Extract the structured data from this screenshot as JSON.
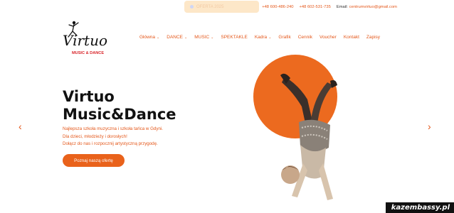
{
  "topbar": {
    "offer_text": "OFERTA 2025",
    "phone1": "+48 600-486-240",
    "phone2": "+48 602-531-735",
    "email_label": "Email:",
    "email": "centrumvirtuo@gmail.com"
  },
  "logo": {
    "wordmark": "Virtuo",
    "tagline": "MUSIC & DANCE"
  },
  "nav": {
    "items": [
      {
        "label": "Główna",
        "dropdown": true
      },
      {
        "label": "DANCE",
        "dropdown": true
      },
      {
        "label": "MUSIC",
        "dropdown": true
      },
      {
        "label": "SPEKTAKLE",
        "dropdown": false
      },
      {
        "label": "Kadra",
        "dropdown": true
      },
      {
        "label": "Grafik",
        "dropdown": false
      },
      {
        "label": "Cennik",
        "dropdown": false
      },
      {
        "label": "Voucher",
        "dropdown": false
      },
      {
        "label": "Kontakt",
        "dropdown": false
      },
      {
        "label": "Zapisy",
        "dropdown": false
      }
    ],
    "chevron": "⌄"
  },
  "hero": {
    "title_line1": "Virtuo",
    "title_line2": "Music&Dance",
    "desc_line1": "Najlepsza szkoła muzyczna i szkoła tańca w Gdyni.",
    "desc_line2": "Dla dzieci, młodzieży i dorosłych!",
    "desc_line3": "Dołącz do nas i rozpocznij artystyczną przygodę.",
    "cta_label": "Poznaj naszą ofertę",
    "prev_arrow": "‹",
    "next_arrow": "›"
  },
  "watermark": "kazembassy.pl",
  "colors": {
    "accent": "#e4571a",
    "circle": "#ec6a1f"
  }
}
